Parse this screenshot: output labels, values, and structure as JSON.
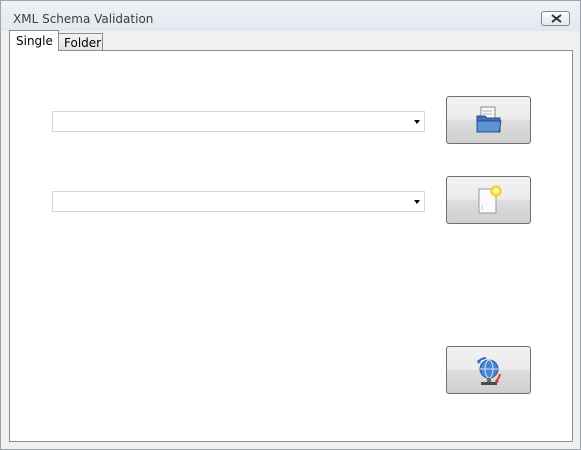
{
  "window": {
    "title": "XML Schema Validation"
  },
  "tabs": [
    {
      "label": "Single",
      "selected": true
    },
    {
      "label": "Folder",
      "selected": false
    }
  ],
  "single": {
    "xml_file_combo": {
      "value": ""
    },
    "schema_file_combo": {
      "value": ""
    },
    "buttons": {
      "open_xml": {
        "icon": "open-folder-icon"
      },
      "new_schema": {
        "icon": "new-document-icon"
      },
      "validate": {
        "icon": "network-globe-icon"
      }
    }
  }
}
